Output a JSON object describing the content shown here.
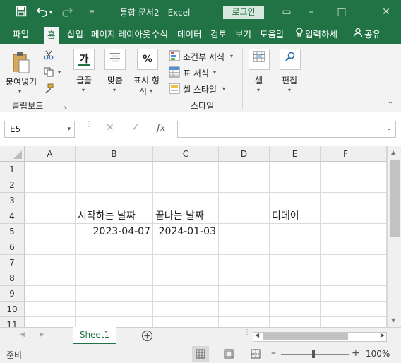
{
  "titlebar": {
    "title": "통합 문서2  -  Excel",
    "login": "로그인",
    "save_icon": "save-icon",
    "undo_icon": "undo-icon",
    "redo_icon": "redo-icon",
    "customize_icon": "customize-qat-icon",
    "bg_color": "#217346"
  },
  "tabs": [
    "파일",
    "홈",
    "삽입",
    "페이지 레이아웃",
    "수식",
    "데이터",
    "검토",
    "보기",
    "도움말"
  ],
  "tell_me": "입력하세",
  "share": "공유",
  "ribbon": {
    "paste": "붙여넣기",
    "clipboard_group": "클립보드",
    "font_btn": "글꼴",
    "font_icon_text": "가",
    "align_btn": "맞춤",
    "number_btn_line1": "표시 형",
    "number_btn_line2": "식",
    "number_icon_text": "%",
    "cond_format": "조건부 서식",
    "table_format": "표 서식",
    "cell_style": "셀 스타일",
    "styles_group": "스타일",
    "cells_btn": "셀",
    "editing_btn": "편집"
  },
  "formula_bar": {
    "name_box": "E5",
    "fx": "fx",
    "formula": ""
  },
  "grid": {
    "columns": [
      "A",
      "B",
      "C",
      "D",
      "E",
      "F"
    ],
    "rows": [
      "1",
      "2",
      "3",
      "4",
      "5",
      "6",
      "7",
      "8",
      "9",
      "10",
      "11"
    ],
    "cells": {
      "B4": "시작하는 날짜",
      "C4": "끝나는 날짜",
      "E4": "디데이",
      "B5": "2023-04-07",
      "C5": "2024-01-03"
    }
  },
  "sheet_tabs": [
    "Sheet1"
  ],
  "status": {
    "ready": "준비",
    "zoom": "100%"
  }
}
